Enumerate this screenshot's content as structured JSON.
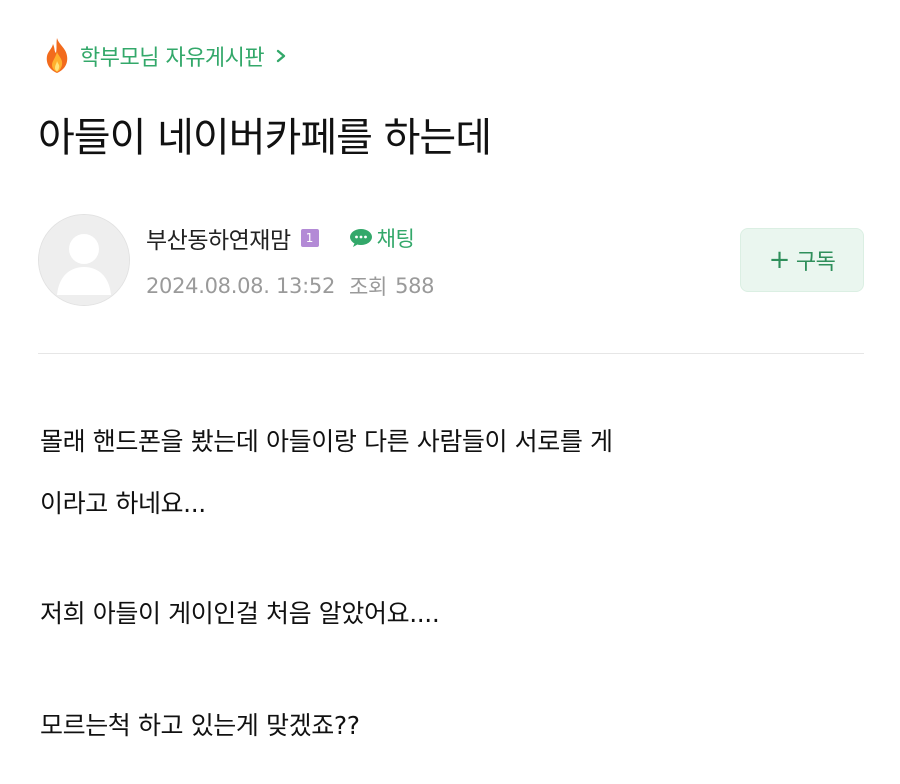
{
  "board": {
    "icon": "fire-icon",
    "name": "학부모님 자유게시판",
    "accent_color": "#33a86a"
  },
  "post": {
    "title": "아들이 네이버카페를 하는데"
  },
  "author": {
    "avatar_icon": "default-avatar-icon",
    "name": "부산동하연재맘",
    "level_badge": "1",
    "chat_label": "채팅",
    "date": "2024.08.08. 13:52",
    "views_label": "조회",
    "views_count": "588"
  },
  "actions": {
    "subscribe_plus": "+",
    "subscribe_label": "구독"
  },
  "content": {
    "paragraph1_line1": "몰래 핸드폰을 봤는데 아들이랑 다른 사람들이 서로를 게",
    "paragraph1_line2": "이라고 하네요...",
    "paragraph2": "저희 아들이 게이인걸 처음 알았어요....",
    "paragraph3": "모르는척 하고 있는게 맞겠죠??"
  }
}
